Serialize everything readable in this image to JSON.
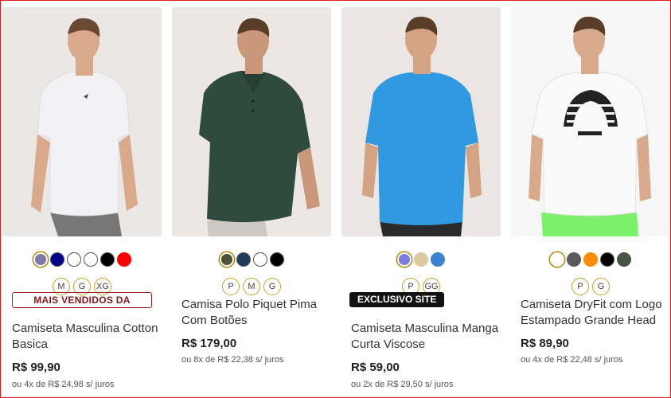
{
  "products": [
    {
      "image_alt": "Camiseta Masculina Cotton Basica",
      "shirt_color": "#f3f3f5",
      "pants_color": "#7a7a7a",
      "swatches": [
        "#7b7aa8",
        "#00008b",
        "#ffffff",
        "#ffffff",
        "#000000",
        "#ff0000"
      ],
      "sizes": [
        "M",
        "G",
        "XG"
      ],
      "badge": "MAIS VENDIDOS DA",
      "title": "Camiseta Masculina Cotton Basica",
      "price": "R$ 99,90",
      "installments": "ou 4x de R$ 24,98 s/ juros"
    },
    {
      "image_alt": "Camisa Polo Piquet Pima Com Botões",
      "shirt_color": "#2e4a3e",
      "pants_color": "#cfc8c2",
      "swatches": [
        "#4d5236",
        "#1f3b5a",
        "#ffffff",
        "#000000"
      ],
      "sizes": [
        "P",
        "M",
        "G"
      ],
      "badge": "",
      "title": "Camisa Polo Piquet Pima Com Botões",
      "price": "R$ 179,00",
      "installments": "ou 8x de R$ 22,38 s/ juros"
    },
    {
      "image_alt": "Camiseta Masculina Manga Curta Viscose",
      "shirt_color": "#2f9ae0",
      "pants_color": "#2a2a2a",
      "swatches": [
        "#7b7ae0",
        "#dec9a0",
        "#3b82d1"
      ],
      "sizes": [
        "P",
        "GG"
      ],
      "badge": "EXCLUSIVO SITE",
      "title": "Camiseta Masculina Manga Curta Viscose",
      "price": "R$ 59,00",
      "installments": "ou 2x de R$ 29,50 s/ juros"
    },
    {
      "image_alt": "Camiseta DryFit com Logo Estampado Grande Head",
      "shirt_color": "#f8f8f8",
      "pants_color": "#7cf06a",
      "swatches": [
        "#ffffff",
        "#5a5a5a",
        "#ff8c00",
        "#000000",
        "#4b5443"
      ],
      "sizes": [
        "P",
        "G"
      ],
      "badge": "",
      "title": "Camiseta DryFit com Logo Estampado Grande Head",
      "price": "R$ 89,90",
      "installments": "ou 4x de R$ 22,48 s/ juros"
    }
  ]
}
